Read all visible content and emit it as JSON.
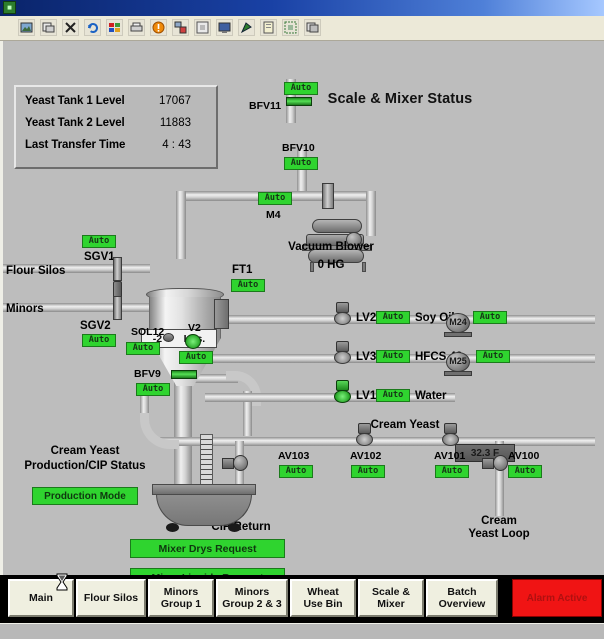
{
  "window": {
    "titlebar_icon": "app-icon",
    "toolbar_icons": [
      "image-icon",
      "new-window-icon",
      "cut-tools-icon",
      "refresh-icon",
      "windows-icon",
      "printer-icon",
      "alarm-icon",
      "network-icon",
      "fullscreen-icon",
      "monitor-icon",
      "pen-arrow-icon",
      "note-icon",
      "selection-icon",
      "copy-window-icon"
    ]
  },
  "info_panel": {
    "rows": [
      {
        "label": "Yeast Tank 1 Level",
        "value": "17067"
      },
      {
        "label": "Yeast Tank 2 Level",
        "value": "11883"
      },
      {
        "label": "Last Transfer Time",
        "value": "4 : 43"
      }
    ]
  },
  "page_title": "Scale & Mixer Status",
  "mimic": {
    "scale_readout": {
      "value": "-2",
      "units": "Lbs."
    },
    "vacuum_blower": {
      "title": "Vacuum Blower",
      "reading": "0 HG",
      "motor": "M4",
      "motor_status": "Auto"
    },
    "temperature": "32.3 F",
    "inlets": [
      {
        "name": "Flour Silos"
      },
      {
        "name": "Minors"
      }
    ],
    "devices": [
      {
        "tag": "BFV11",
        "status": "Auto"
      },
      {
        "tag": "BFV10",
        "status": "Auto"
      },
      {
        "tag": "SGV1",
        "status": "Auto"
      },
      {
        "tag": "SGV2",
        "status": "Auto"
      },
      {
        "tag": "FT1",
        "status": "Auto"
      },
      {
        "tag": "SOL12",
        "status": "Auto"
      },
      {
        "tag": "V2",
        "status": "Auto"
      },
      {
        "tag": "BFV9",
        "status": "Auto"
      },
      {
        "tag": "LV2",
        "status": "Auto",
        "service": "Soy Oil"
      },
      {
        "tag": "LV3",
        "status": "Auto",
        "service": "HFCS 42"
      },
      {
        "tag": "LV1",
        "status": "Auto",
        "service": "Water"
      },
      {
        "tag": "M24",
        "status": "Auto"
      },
      {
        "tag": "M25",
        "status": "Auto"
      },
      {
        "tag": "AV103",
        "status": "Auto"
      },
      {
        "tag": "AV102",
        "status": "Auto"
      },
      {
        "tag": "AV101",
        "status": "Auto"
      },
      {
        "tag": "AV100",
        "status": "Auto"
      }
    ],
    "line_labels": [
      {
        "text": "Cream Yeast"
      },
      {
        "text": "CIP Return"
      },
      {
        "text": "Cream Yeast Loop"
      }
    ],
    "cip_status": {
      "title_line1": "Cream Yeast",
      "title_line2": "Production/CIP Status",
      "mode": "Production Mode"
    },
    "requests": [
      {
        "label": "Mixer Drys Request"
      },
      {
        "label": "Mixer Liquids Request"
      }
    ]
  },
  "navbar": {
    "buttons": [
      {
        "line1": "Main",
        "line2": ""
      },
      {
        "line1": "Flour Silos",
        "line2": ""
      },
      {
        "line1": "Minors",
        "line2": "Group 1"
      },
      {
        "line1": "Minors",
        "line2": "Group 2 & 3"
      },
      {
        "line1": "Wheat",
        "line2": "Use Bin"
      },
      {
        "line1": "Scale &",
        "line2": "Mixer"
      },
      {
        "line1": "Batch",
        "line2": "Overview"
      }
    ],
    "alarm": "Alarm Active"
  },
  "colors": {
    "auto_green": "#2fd42f",
    "alarm_red": "#f01414",
    "mimic_bg": "#bdbdbd",
    "panel_bg": "#b9b9b9"
  }
}
